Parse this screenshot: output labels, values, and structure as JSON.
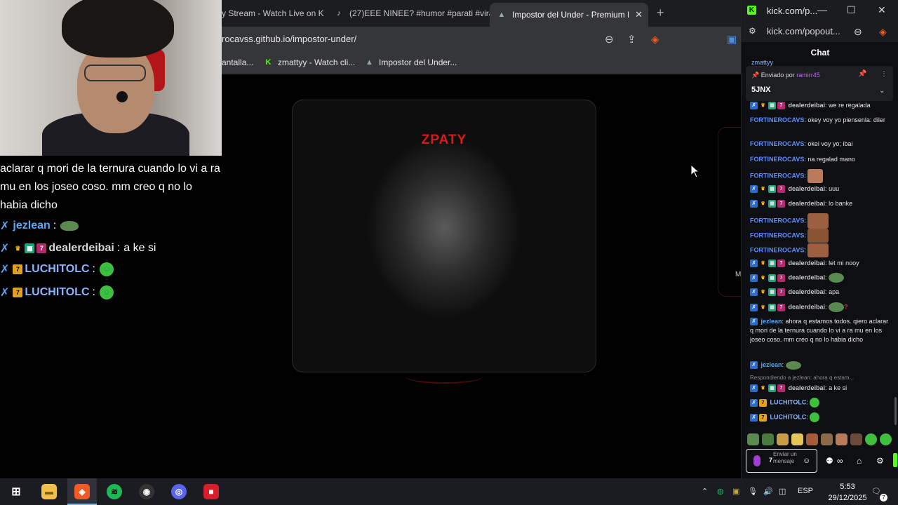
{
  "browser": {
    "tabs": [
      {
        "label": "y Stream - Watch Live on K",
        "icon": "kick-icon"
      },
      {
        "label": "(27)EEE NINEE? #humor #parati #vira",
        "icon": "tiktok-icon"
      },
      {
        "label": "Impostor del Under - Premium E",
        "icon": "game-icon"
      }
    ],
    "url": "rocavss.github.io/impostor-under/",
    "bookmarks": [
      "antalla...",
      "zmattyy - Watch cli...",
      "Impostor del Under..."
    ]
  },
  "game": {
    "logo": "ZPATY",
    "side_letter": "M"
  },
  "overlay": {
    "message_text": "aclarar q mori de la ternura cuando lo vi a ra mu en los joseo coso. mm creo q no lo habia dicho",
    "lines": [
      {
        "user": "jezlean",
        "text": "",
        "color": "#5aa9f5"
      },
      {
        "user": "dealerdeibai",
        "text": "a ke si",
        "color": "#d6d6d6"
      },
      {
        "user": "LUCHITOLC",
        "text": "",
        "color": "#8ab4ff"
      },
      {
        "user": "LUCHITOLC",
        "text": "",
        "color": "#8ab4ff"
      }
    ]
  },
  "chat_window": {
    "title": "kick.com/p...",
    "url": "kick.com/popout...",
    "header": "Chat",
    "pinned_by_label": "Enviado por",
    "pinned_by_user": "ramirr45",
    "pinned_message": "5JNX",
    "top_user": "zmattyy",
    "messages": [
      {
        "user": "dealerdeibai",
        "text": "we re regalada",
        "color": "#c9c9c9"
      },
      {
        "user": "FORTINEROCAVS",
        "text": "okey voy yo piensenla: diler",
        "color": "#5c8dff"
      },
      {
        "user": "FORTINEROCAVS",
        "text": "okei voy yo; ibai",
        "color": "#5c8dff"
      },
      {
        "user": "FORTINEROCAVS",
        "text": "na regalad mano",
        "color": "#5c8dff"
      },
      {
        "user": "FORTINEROCAVS",
        "text": "",
        "color": "#5c8dff"
      },
      {
        "user": "dealerdeibai",
        "text": "uuu",
        "color": "#c9c9c9"
      },
      {
        "user": "dealerdeibai",
        "text": "lo banke",
        "color": "#c9c9c9"
      },
      {
        "user": "FORTINEROCAVS",
        "text": "",
        "color": "#5c8dff"
      },
      {
        "user": "FORTINEROCAVS",
        "text": "",
        "color": "#5c8dff"
      },
      {
        "user": "FORTINEROCAVS",
        "text": "",
        "color": "#5c8dff"
      },
      {
        "user": "dealerdeibai",
        "text": "let mi nooy",
        "color": "#c9c9c9"
      },
      {
        "user": "dealerdeibai",
        "text": "",
        "color": "#c9c9c9"
      },
      {
        "user": "dealerdeibai",
        "text": "apa",
        "color": "#c9c9c9"
      },
      {
        "user": "dealerdeibai",
        "text": "",
        "color": "#c9c9c9"
      },
      {
        "user": "jezlean",
        "text": "ahora q estamos todos. qiero aclarar q mori de la ternura cuando lo vi a ra mu en los joseo coso. mm creo q no lo habia dicho",
        "color": "#5aa9f5"
      },
      {
        "user": "jezlean",
        "text": "",
        "color": "#5aa9f5"
      },
      {
        "user": "dealerdeibai",
        "text": "a ke si",
        "color": "#c9c9c9"
      },
      {
        "user": "LUCHITOLC",
        "text": "",
        "color": "#8ab4ff"
      },
      {
        "user": "LUCHITOLC",
        "text": "",
        "color": "#8ab4ff"
      }
    ],
    "reply_text": "Respondiendo a jezlean: ahora q estam...",
    "input_placeholder": "Enviar un mensaje"
  },
  "taskbar": {
    "lang": "ESP",
    "time": "5:53",
    "date": "29/12/2025",
    "notif_count": "7"
  }
}
